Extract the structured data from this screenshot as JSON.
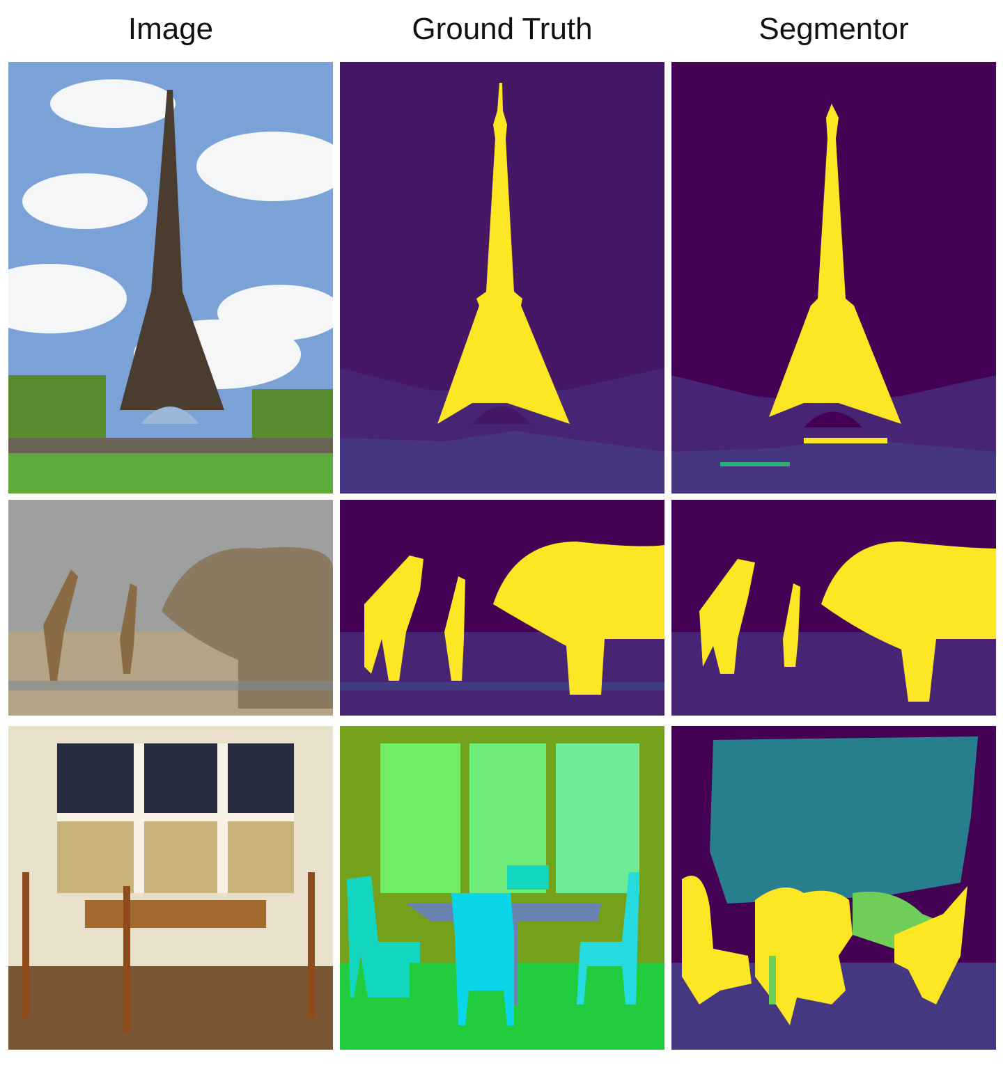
{
  "headers": {
    "image": "Image",
    "ground_truth": "Ground Truth",
    "segmentor": "Segmentor"
  },
  "palette": {
    "background_class": "#440154",
    "sky_purple": "#461764",
    "ground_dark": "#482475",
    "ground_mid": "#463681",
    "target_yellow": "#FDE725",
    "teal_wall": "#277F8E",
    "light_green": "#6ECE58",
    "cyan_chair": "#0BD6E8",
    "green_floor": "#22CC3F",
    "olive_wall": "#74A01A",
    "window_green": "#72EC64",
    "table_slate": "#6A82B1"
  },
  "rows": [
    {
      "scene": "eiffel-tower"
    },
    {
      "scene": "giraffes-elephant"
    },
    {
      "scene": "dining-room"
    }
  ]
}
